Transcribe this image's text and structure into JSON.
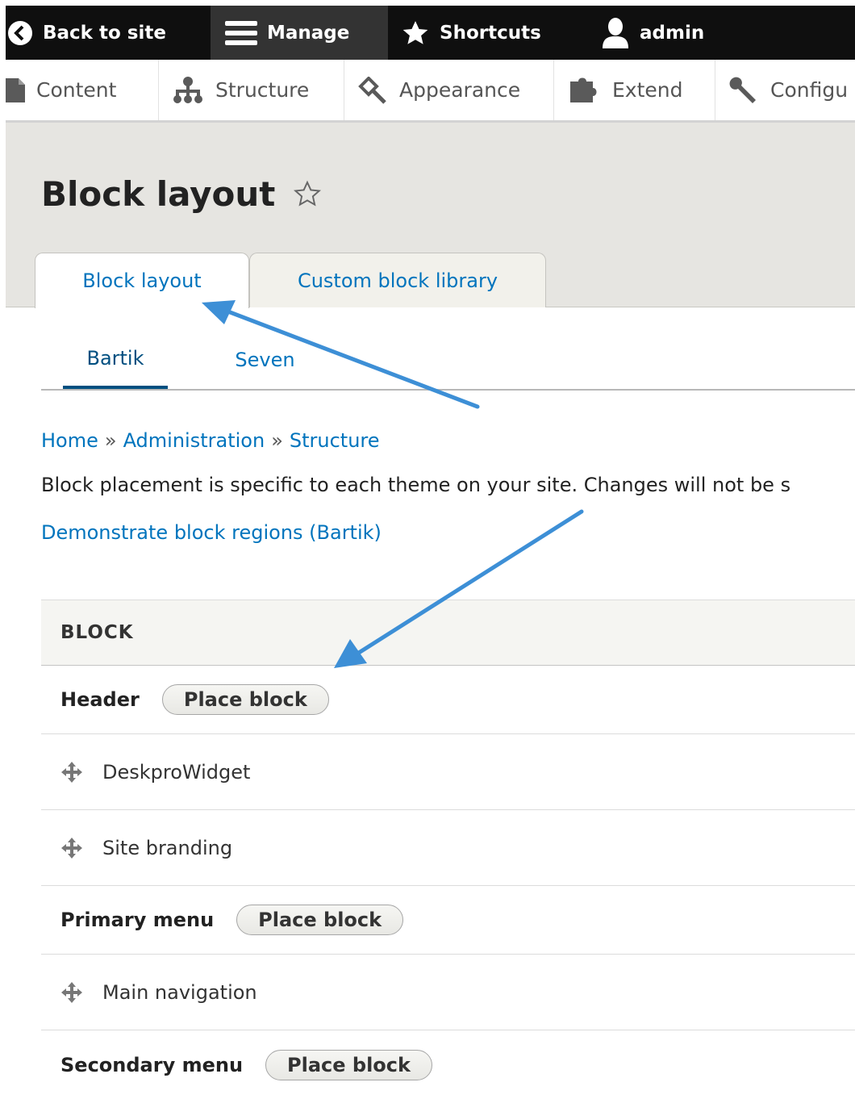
{
  "toolbar": {
    "back": "Back to site",
    "manage": "Manage",
    "shortcuts": "Shortcuts",
    "user": "admin"
  },
  "tray": {
    "items": [
      "Content",
      "Structure",
      "Appearance",
      "Extend",
      "Configu"
    ]
  },
  "page": {
    "title": "Block layout"
  },
  "tabs": [
    "Block layout",
    "Custom block library"
  ],
  "subtabs": [
    "Bartik",
    "Seven"
  ],
  "breadcrumb": [
    "Home",
    "Administration",
    "Structure"
  ],
  "breadcrumb_sep": "»",
  "help_text": "Block placement is specific to each theme on your site. Changes will not be s",
  "demo_link": "Demonstrate block regions (Bartik)",
  "table": {
    "header": "BLOCK",
    "place_block": "Place block",
    "regions": [
      {
        "name": "Header",
        "blocks": [
          "DeskproWidget",
          "Site branding"
        ]
      },
      {
        "name": "Primary menu",
        "blocks": [
          "Main navigation"
        ]
      },
      {
        "name": "Secondary menu",
        "blocks": []
      }
    ]
  },
  "colors": {
    "link": "#0074bd",
    "annotation_arrow": "#3d8fd6",
    "toolbar": "#0f0f0f"
  }
}
